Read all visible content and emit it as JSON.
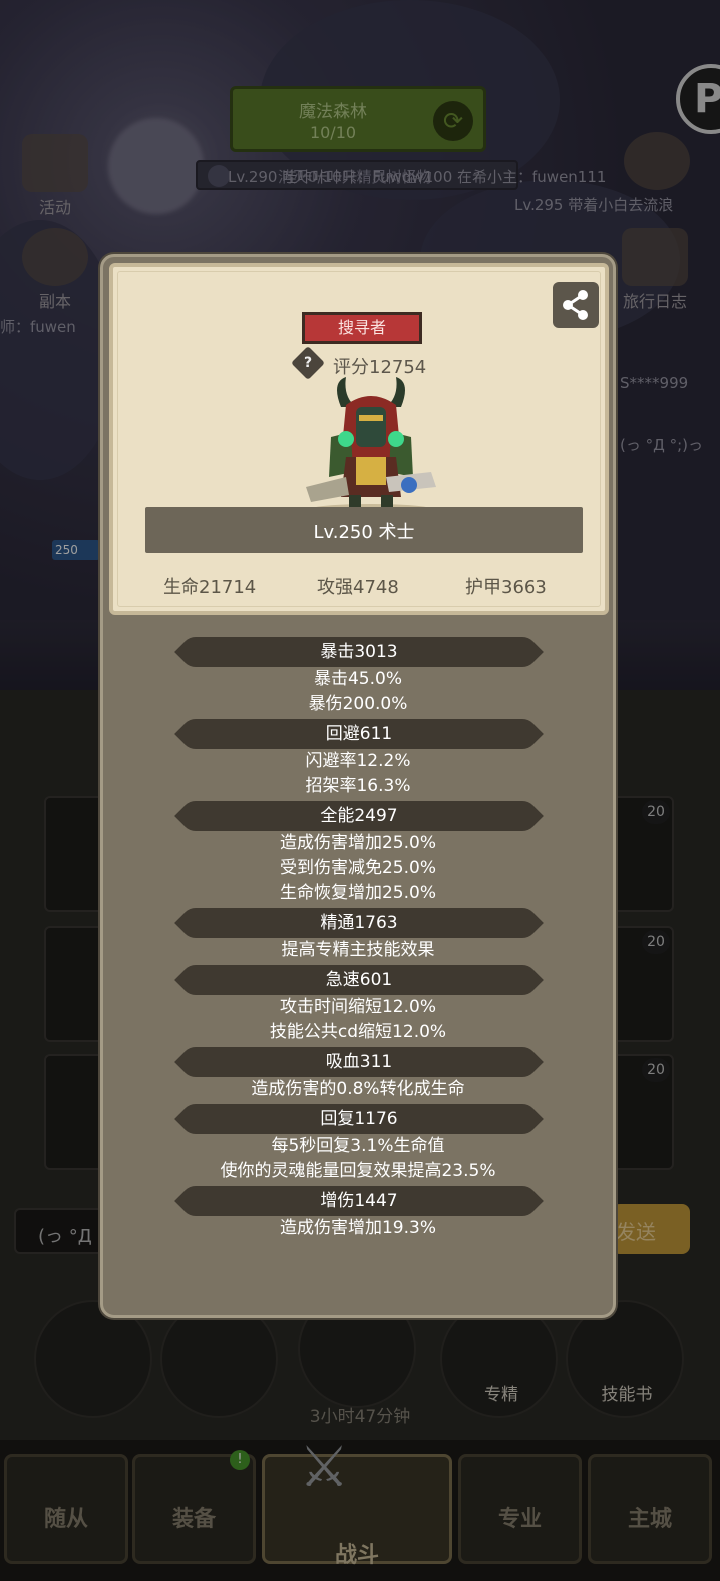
{
  "background": {
    "map_name": "魔法森林",
    "map_progress": "10/10",
    "quest_text": "消灭0/10只精灵树怪物",
    "chat_lines": [
      "Lv.290 哇咔咔咔咔：Fuwdw100 在希小主：fuwen111",
      "Lv.295 带着小白去流浪",
      "师：fuwen",
      "S****999",
      "(っ °Д °;)っ"
    ],
    "side_icons": {
      "activity": "活动",
      "dungeon": "副本",
      "travel_log": "旅行日志"
    },
    "badge_level": "250",
    "slot_levels": [
      "20",
      "20",
      "20"
    ],
    "chat_input_value": "(っ °Д °",
    "send_label": "发送",
    "round_buttons": {
      "specialty": "专精",
      "skill_book": "技能书"
    },
    "timer": "3小时47分钟",
    "nav": {
      "follower": "随从",
      "equipment": "装备",
      "battle": "战斗",
      "profession": "专业",
      "main_city": "主城"
    },
    "notification_count": "!"
  },
  "profile": {
    "role_tag": "搜寻者",
    "help_icon_glyph": "?",
    "score": "评分12754",
    "name_line": "Lv.250 术士",
    "hp": "生命21714",
    "attack": "攻强4748",
    "armor": "护甲3663"
  },
  "attributes": [
    {
      "header": "暴击3013",
      "lines": [
        "暴击45.0%",
        "暴伤200.0%"
      ]
    },
    {
      "header": "回避611",
      "lines": [
        "闪避率12.2%",
        "招架率16.3%"
      ]
    },
    {
      "header": "全能2497",
      "lines": [
        "造成伤害增加25.0%",
        "受到伤害减免25.0%",
        "生命恢复增加25.0%"
      ]
    },
    {
      "header": "精通1763",
      "lines": [
        "提高专精主技能效果"
      ]
    },
    {
      "header": "急速601",
      "lines": [
        "攻击时间缩短12.0%",
        "技能公共cd缩短12.0%"
      ]
    },
    {
      "header": "吸血311",
      "lines": [
        "造成伤害的0.8%转化成生命"
      ]
    },
    {
      "header": "回复1176",
      "lines": [
        "每5秒回复3.1%生命值",
        "使你的灵魂能量回复效果提高23.5%"
      ]
    },
    {
      "header": "增伤1447",
      "lines": [
        "造成伤害增加19.3%"
      ]
    }
  ],
  "colors": {
    "panel": "#7b7363",
    "card": "#ebe0c5",
    "role_tag": "#b73737",
    "attr_bar": "#3f3930",
    "map_button": "#5d7c2c"
  }
}
